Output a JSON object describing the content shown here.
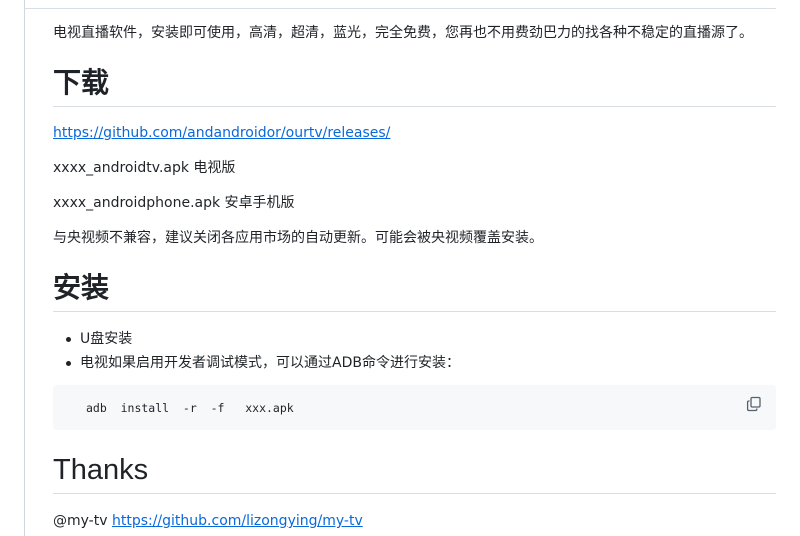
{
  "intro": "电视直播软件，安装即可使用，高清，超清，蓝光，完全免费，您再也不用费劲巴力的找各种不稳定的直播源了。",
  "download": {
    "heading": "下载",
    "release_url": "https://github.com/andandroidor/ourtv/releases/",
    "tv_apk": "xxxx_androidtv.apk 电视版",
    "phone_apk": "xxxx_androidphone.apk 安卓手机版",
    "note": "与央视频不兼容，建议关闭各应用市场的自动更新。可能会被央视频覆盖安装。"
  },
  "install": {
    "heading": "安装",
    "items": [
      "U盘安装",
      "电视如果启用开发者调试模式，可以通过ADB命令进行安装："
    ],
    "command": "adb  install  -r  -f   xxx.apk"
  },
  "thanks": {
    "heading": "Thanks",
    "prefix": "@my-tv",
    "url": "https://github.com/lizongying/my-tv"
  }
}
